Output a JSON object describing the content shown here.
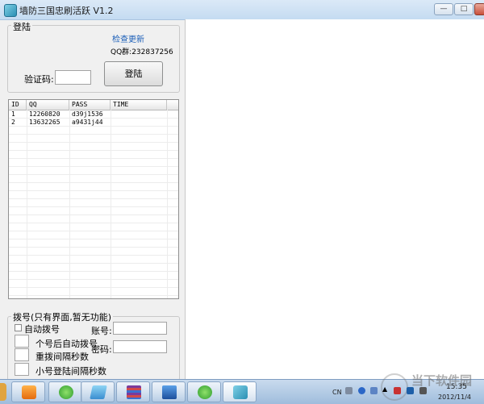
{
  "window": {
    "title": "墙防三国忠刷活跃 V1.2",
    "minimize_label": "—",
    "maximize_label": "□",
    "close_label": "✕"
  },
  "login": {
    "group_title": "登陆",
    "check_update": "检查更新",
    "qq_group": "QQ群:232837256",
    "captcha_label": "验证码:",
    "captcha_value": "",
    "login_button": "登陆"
  },
  "table": {
    "columns": [
      "ID",
      "QQ",
      "PASS",
      "TIME"
    ],
    "rows": [
      {
        "id": "1",
        "qq": "12260820",
        "pass": "d39j1536",
        "time": ""
      },
      {
        "id": "2",
        "qq": "13632265",
        "pass": "a9431j44",
        "time": ""
      }
    ]
  },
  "dial": {
    "group_title": "拨号(只有界面,暂无功能)",
    "auto_dial": "自动拨号",
    "auto_after": "个号后自动拨号",
    "redial_interval": "重拨间隔秒数",
    "small_login_interval": "小号登陆间隔秒数",
    "account_label": "账号:",
    "password_label": "密码:",
    "account_value": "",
    "password_value": ""
  },
  "taskbar": {
    "lang": "CN",
    "time": "15:35",
    "date": "2012/11/4",
    "watermark": "当下软件园"
  },
  "colors": {
    "link": "#1c5fb8",
    "taskbar": "#a9c3df"
  }
}
